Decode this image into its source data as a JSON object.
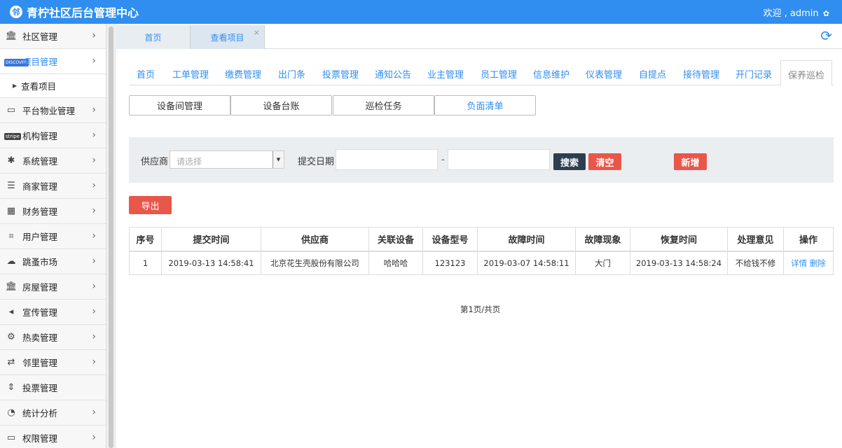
{
  "header": {
    "app_title": "青柠社区后台管理中心",
    "logo_glyph": "邻",
    "welcome": "欢迎 , admin"
  },
  "sidebar": {
    "items": [
      {
        "label": "社区管理",
        "icon": "bank-icon"
      },
      {
        "label": "项目管理",
        "icon": "discover-card-icon",
        "icon_text": "DISCOVER"
      },
      {
        "label": "平台物业管理",
        "icon": "desktop-icon"
      },
      {
        "label": "机构管理",
        "icon": "stripe-icon",
        "icon_text": "stripe"
      },
      {
        "label": "系统管理",
        "icon": "yelp-icon"
      },
      {
        "label": "商家管理",
        "icon": "list-icon"
      },
      {
        "label": "财务管理",
        "icon": "calculator-icon"
      },
      {
        "label": "用户管理",
        "icon": "crop-icon"
      },
      {
        "label": "跳蚤市场",
        "icon": "cloud-icon"
      },
      {
        "label": "房屋管理",
        "icon": "bank-icon"
      },
      {
        "label": "宣传管理",
        "icon": "volume-icon"
      },
      {
        "label": "热卖管理",
        "icon": "gear-outline-icon"
      },
      {
        "label": "邻里管理",
        "icon": "retweet-icon"
      },
      {
        "label": "投票管理",
        "icon": "sort-icon"
      },
      {
        "label": "统计分析",
        "icon": "pie-chart-icon"
      },
      {
        "label": "权限管理",
        "icon": "desktop-icon"
      }
    ],
    "sub_item": "查看项目"
  },
  "page_tabs": [
    {
      "label": "首页"
    },
    {
      "label": "查看项目",
      "close": "×"
    }
  ],
  "nav_tabs": [
    "首页",
    "工单管理",
    "缴费管理",
    "出门条",
    "投票管理",
    "通知公告",
    "业主管理",
    "员工管理",
    "信息维护",
    "仪表管理",
    "自提点",
    "接待管理",
    "开门记录",
    "保养巡检"
  ],
  "sub_buttons": [
    "设备间管理",
    "设备台账",
    "巡检任务",
    "负面清单"
  ],
  "filter": {
    "supplier_label": "供应商",
    "supplier_placeholder": "请选择",
    "date_label": "提交日期",
    "dash": "-",
    "search": "搜索",
    "clear": "清空",
    "add": "新增"
  },
  "export_label": "导出",
  "table": {
    "headers": [
      "序号",
      "提交时间",
      "供应商",
      "关联设备",
      "设备型号",
      "故障时间",
      "故障现象",
      "恢复时间",
      "处理意见",
      "操作"
    ],
    "rows": [
      {
        "no": "1",
        "submit_time": "2019-03-13 14:58:41",
        "supplier": "北京花生壳股份有限公司",
        "device": "哈哈哈",
        "model": "123123",
        "fault_time": "2019-03-07 14:58:11",
        "phenomenon": "大门",
        "recover_time": "2019-03-13 14:58:24",
        "opinion": "不给钱不修",
        "detail": "详情",
        "delete": "删除"
      }
    ]
  },
  "pager": "第1页/共页",
  "colors": {
    "primary": "#2f8ef0",
    "danger": "#e9574a",
    "dark": "#2c3e50"
  }
}
